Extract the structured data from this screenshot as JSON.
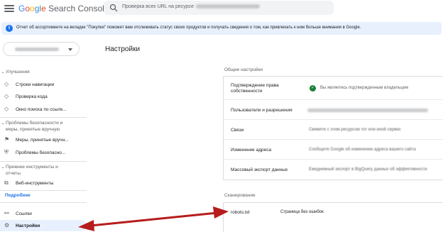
{
  "header": {
    "logo_g": "G",
    "logo_o1": "o",
    "logo_o2": "o",
    "logo_g2": "g",
    "logo_l": "l",
    "logo_e": "e",
    "logo_product": "Search Console",
    "search_placeholder": "Проверка всех URL на ресурсе"
  },
  "banner": {
    "text": "Отчет об ассортименте на вкладке \"Покупки\" поможет вам отслеживать статус своих продуктов и получать сведения о том, как привлекать к ним больше внимания в Google."
  },
  "sidebar": {
    "sections": [
      {
        "label": "Улучшения"
      },
      {
        "label": "Проблемы безопасности и"
      },
      {
        "label": "меры, принятые вручную"
      },
      {
        "label": "Прежние инструменты и"
      },
      {
        "label": "отчеты"
      }
    ],
    "items": [
      {
        "label": "Строки навигации",
        "icon": "diamond-icon"
      },
      {
        "label": "Проверка кода",
        "icon": "diamond-icon"
      },
      {
        "label": "Окно поиска по ссылк...",
        "icon": "diamond-icon"
      },
      {
        "label": "Меры, принятые вручн...",
        "icon": "flag-icon"
      },
      {
        "label": "Проблемы безопасно...",
        "icon": "shield-icon"
      },
      {
        "label": "Веб-инструменты",
        "icon": "external-link-icon"
      },
      {
        "label": "Ссылки",
        "icon": "links-icon"
      },
      {
        "label": "Настройки",
        "icon": "gear-icon"
      }
    ],
    "feedback_link": "Подробнее"
  },
  "main": {
    "title": "Настройки",
    "general_label": "Общие настройки",
    "general_rows": [
      {
        "label": "Подтверждение права собственности",
        "value": "Вы являетесь подтвержденным владельцем"
      },
      {
        "label": "Пользователи и разрешения",
        "value": ""
      },
      {
        "label": "Связи",
        "value": "Свяжите с этим ресурсом тот или иной сервис"
      },
      {
        "label": "Изменение адреса",
        "value": "Сообщите Google об изменении адреса вашего сайта"
      },
      {
        "label": "Массовый экспорт данных",
        "value": "Ежедневный экспорт в BigQuery данных об эффективности"
      }
    ],
    "crawl_label": "Сканирование",
    "crawl_rows": [
      {
        "label": "robots.txt",
        "value": "Страница без ошибок"
      }
    ]
  },
  "colors": {
    "accent": "#1a73e8",
    "arrow": "#b71c1c",
    "banner_bg": "#e8f0fe",
    "success": "#188038"
  }
}
